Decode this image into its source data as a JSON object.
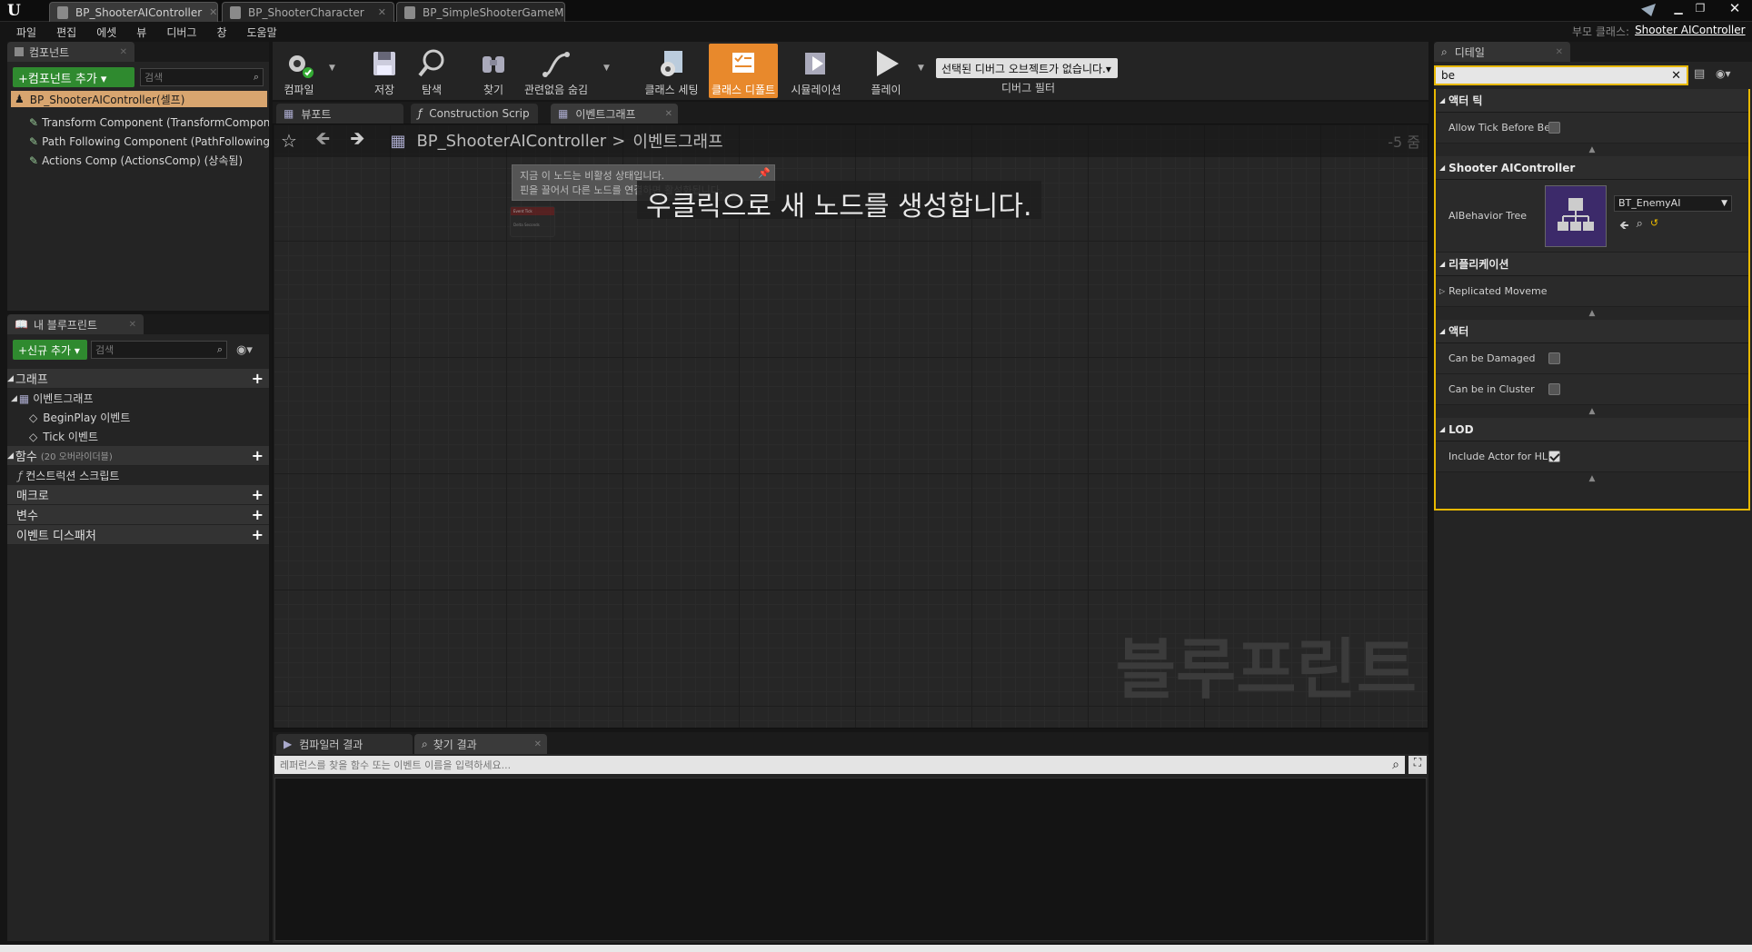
{
  "tabs": [
    {
      "label": "BP_ShooterAIController"
    },
    {
      "label": "BP_ShooterCharacter"
    },
    {
      "label": "BP_SimpleShooterGameM"
    }
  ],
  "topright": {
    "parent_label": "부모 클래스:",
    "parent_value": "Shooter AIController"
  },
  "menu": [
    "파일",
    "편집",
    "에셋",
    "뷰",
    "디버그",
    "창",
    "도움말"
  ],
  "components": {
    "tab": "컴포넌트",
    "add_button": "+컴포넌트 추가 ▾",
    "search_placeholder": "검색",
    "root": "BP_ShooterAIController(셀프)",
    "items": [
      "Transform Component (TransformComponer",
      "Path Following Component (PathFollowingC",
      "Actions Comp (ActionsComp) (상속됨)"
    ]
  },
  "myblueprint": {
    "tab": "내 블루프린트",
    "add_button": "+신규 추가 ▾",
    "search_placeholder": "검색",
    "graph_section": "그래프",
    "event_graph": "이벤트그래프",
    "events": [
      "BeginPlay 이벤트",
      "Tick 이벤트"
    ],
    "functions_section": "함수",
    "functions_count": "(20 오버라이더블)",
    "construction": "컨스트럭션 스크립트",
    "macros": "매크로",
    "variables": "변수",
    "dispatchers": "이벤트 디스패처"
  },
  "toolbar": {
    "compile": "컴파일",
    "save": "저장",
    "browse": "탐색",
    "find": "찾기",
    "hide_unrelated": "관련없음 숨김",
    "class_settings": "클래스 세팅",
    "class_defaults": "클래스 디폴트",
    "simulation": "시뮬레이션",
    "play": "플레이",
    "debug_select": "선택된 디버그 오브젝트가 없습니다.▾",
    "debug_filter": "디버그 필터"
  },
  "editor_tabs": [
    "뷰포트",
    "Construction Scrip",
    "이벤트그래프"
  ],
  "graph": {
    "breadcrumb_root": "BP_ShooterAIController",
    "breadcrumb_sep": ">",
    "breadcrumb_leaf": "이벤트그래프",
    "zoom": "-5 줌",
    "tooltip_line1": "지금 이 노드는 비활성 상태입니다.",
    "tooltip_line2": "핀을 끌어서 다른 노드를 연결하면 활성화됩니다.",
    "hint": "우클릭으로 새 노드를 생성합니다.",
    "watermark": "블루프린트",
    "node_title": "Event Tick",
    "node_pin": "Delta Seconds"
  },
  "bottom": {
    "tab_compiler": "컴파일러 결과",
    "tab_find": "찾기 결과",
    "find_placeholder": "레퍼런스를 찾을 함수 또는 이벤트 이름을 입력하세요..."
  },
  "details": {
    "tab": "디테일",
    "search_value": "be",
    "sections": {
      "tick": "액터 틱",
      "shooter": "Shooter AIController",
      "replication": "리플리케이션",
      "actor": "액터",
      "lod": "LOD"
    },
    "allow_tick": "Allow Tick Before Be",
    "behavior_tree_label": "AIBehavior Tree",
    "behavior_tree_value": "BT_EnemyAI",
    "replicated_movement": "Replicated Moveme",
    "can_be_damaged": "Can be Damaged",
    "can_be_in_cluster": "Can be in Cluster",
    "include_actor": "Include Actor for HL"
  },
  "colors": {
    "accent_orange": "#e8892c",
    "green": "#2f8a2f",
    "highlight_yellow": "#e8b800"
  }
}
